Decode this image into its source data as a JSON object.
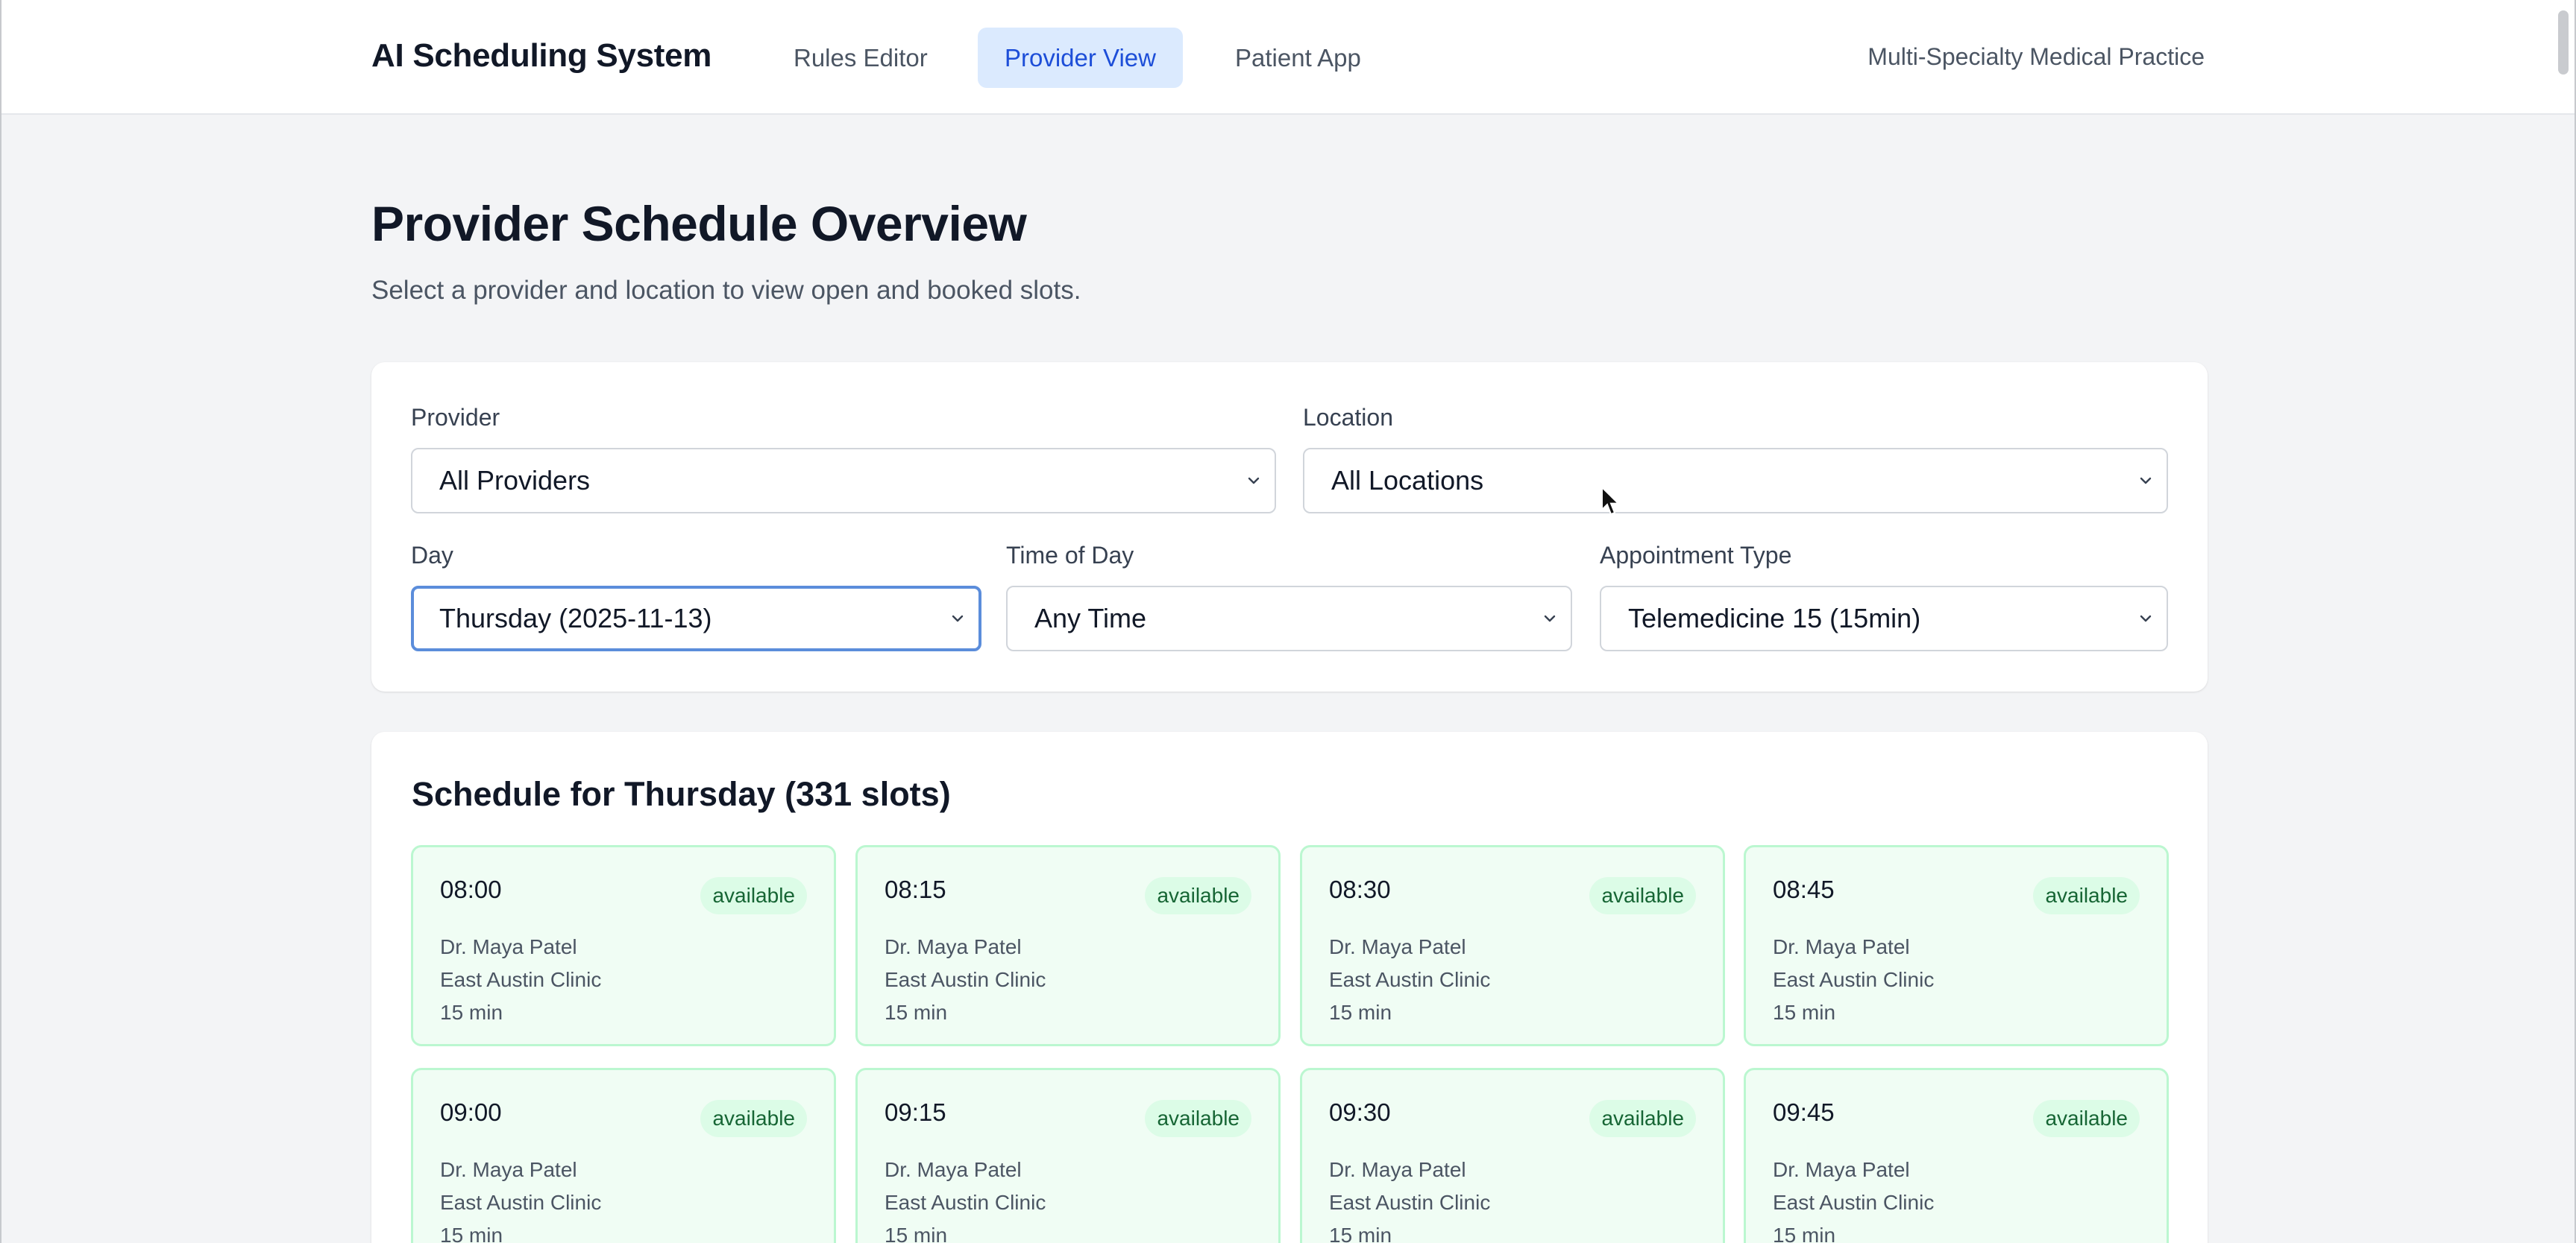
{
  "header": {
    "brand": "AI Scheduling System",
    "tabs": [
      {
        "label": "Rules Editor",
        "active": false
      },
      {
        "label": "Provider View",
        "active": true
      },
      {
        "label": "Patient App",
        "active": false
      }
    ],
    "practice_name": "Multi-Specialty Medical Practice"
  },
  "page": {
    "title": "Provider Schedule Overview",
    "subtitle": "Select a provider and location to view open and booked slots."
  },
  "filters": {
    "provider": {
      "label": "Provider",
      "value": "All Providers"
    },
    "location": {
      "label": "Location",
      "value": "All Locations"
    },
    "day": {
      "label": "Day",
      "value": "Thursday (2025-11-13)"
    },
    "time_of_day": {
      "label": "Time of Day",
      "value": "Any Time"
    },
    "appointment_type": {
      "label": "Appointment Type",
      "value": "Telemedicine 15 (15min)"
    }
  },
  "schedule": {
    "title": "Schedule for Thursday (331 slots)",
    "slots": [
      {
        "time": "08:00",
        "status": "available",
        "provider": "Dr. Maya Patel",
        "location": "East Austin Clinic",
        "duration": "15 min"
      },
      {
        "time": "08:15",
        "status": "available",
        "provider": "Dr. Maya Patel",
        "location": "East Austin Clinic",
        "duration": "15 min"
      },
      {
        "time": "08:30",
        "status": "available",
        "provider": "Dr. Maya Patel",
        "location": "East Austin Clinic",
        "duration": "15 min"
      },
      {
        "time": "08:45",
        "status": "available",
        "provider": "Dr. Maya Patel",
        "location": "East Austin Clinic",
        "duration": "15 min"
      },
      {
        "time": "09:00",
        "status": "available",
        "provider": "Dr. Maya Patel",
        "location": "East Austin Clinic",
        "duration": "15 min"
      },
      {
        "time": "09:15",
        "status": "available",
        "provider": "Dr. Maya Patel",
        "location": "East Austin Clinic",
        "duration": "15 min"
      },
      {
        "time": "09:30",
        "status": "available",
        "provider": "Dr. Maya Patel",
        "location": "East Austin Clinic",
        "duration": "15 min"
      },
      {
        "time": "09:45",
        "status": "available",
        "provider": "Dr. Maya Patel",
        "location": "East Austin Clinic",
        "duration": "15 min"
      }
    ]
  },
  "colors": {
    "accent": "#1d4ed8",
    "accent_bg": "#dbeafe",
    "available_bg": "#f0fdf4",
    "available_border": "#bbf7d0",
    "available_badge_text": "#166534"
  }
}
